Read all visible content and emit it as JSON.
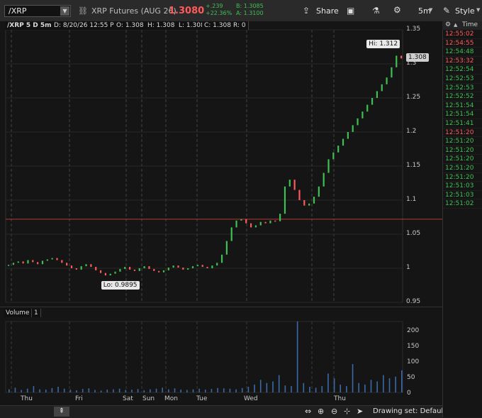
{
  "toolbar": {
    "symbol": "/XRP",
    "description": "XRP Futures (AUG 26)",
    "last": "1.3080",
    "change_abs": "+.239",
    "change_pct": "+22.36%",
    "bid": "B: 1.3085",
    "ask": "A: 1.3100",
    "share_label": "Share",
    "timeframe_label": "5m",
    "style_label": "Style"
  },
  "chart_header": {
    "title": "/XRP 5 D 5m",
    "date": "D: 8/20/26 12:55 PM",
    "open": "O: 1.308",
    "high": "H: 1.308",
    "low": "L: 1.308",
    "close": "C: 1.308",
    "range": "R: 0"
  },
  "annotations": {
    "hi_label": "Hi: 1.312",
    "lo_label": "Lo: 0.9895",
    "last_price_tag": "1.308"
  },
  "volume": {
    "title": "Volume",
    "badge": "1",
    "axis": [
      "200",
      "150",
      "100",
      "50",
      "0"
    ]
  },
  "bottom": {
    "drawing_set": "Drawing set: Default"
  },
  "tape": {
    "header": "Time",
    "rows": [
      {
        "t": "12:55:02",
        "c": "red"
      },
      {
        "t": "12:54:55",
        "c": "red"
      },
      {
        "t": "12:54:48",
        "c": "grn"
      },
      {
        "t": "12:53:32",
        "c": "red"
      },
      {
        "t": "12:52:54",
        "c": "grn"
      },
      {
        "t": "12:52:53",
        "c": "grn"
      },
      {
        "t": "12:52:53",
        "c": "grn"
      },
      {
        "t": "12:52:52",
        "c": "grn"
      },
      {
        "t": "12:51:54",
        "c": "grn"
      },
      {
        "t": "12:51:54",
        "c": "grn"
      },
      {
        "t": "12:51:41",
        "c": "grn"
      },
      {
        "t": "12:51:20",
        "c": "red"
      },
      {
        "t": "12:51:20",
        "c": "grn"
      },
      {
        "t": "12:51:20",
        "c": "grn"
      },
      {
        "t": "12:51:20",
        "c": "grn"
      },
      {
        "t": "12:51:20",
        "c": "grn"
      },
      {
        "t": "12:51:20",
        "c": "grn"
      },
      {
        "t": "12:51:03",
        "c": "grn"
      },
      {
        "t": "12:51:03",
        "c": "grn"
      },
      {
        "t": "12:51:02",
        "c": "grn"
      }
    ]
  },
  "chart_data": {
    "type": "line",
    "x_ticks": [
      "Thu",
      "Fri",
      "Sat",
      "Sun",
      "Mon",
      "Tue",
      "Wed",
      "Thu"
    ],
    "y_ticks": [
      1.35,
      1.3,
      1.25,
      1.2,
      1.15,
      1.1,
      1.05,
      1,
      0.95
    ],
    "ylim": [
      0.95,
      1.35
    ],
    "price_line": 1.072,
    "high": 1.312,
    "low": 0.9895,
    "last": 1.308,
    "series": [
      {
        "values": [
          1.005,
          1.008,
          1.01,
          1.007,
          1.012,
          1.009,
          1.006,
          1.011,
          1.013,
          1.015,
          1.012,
          1.008,
          1.004,
          1.0,
          0.998,
          1.003,
          1.006,
          1.002,
          0.997,
          0.993,
          0.9895,
          0.992,
          0.995,
          0.999,
          1.002,
          0.998,
          0.996,
          1.0,
          1.003,
          0.999,
          0.996,
          0.994,
          0.997,
          1.001,
          1.004,
          1.001,
          0.998,
          1.0,
          1.003,
          1.005,
          1.002,
          1.0,
          1.004,
          1.008,
          1.02,
          1.04,
          1.06,
          1.07,
          1.072,
          1.066,
          1.06,
          1.063,
          1.068,
          1.066,
          1.07,
          1.069,
          1.08,
          1.12,
          1.13,
          1.115,
          1.1,
          1.092,
          1.095,
          1.105,
          1.12,
          1.14,
          1.16,
          1.17,
          1.18,
          1.19,
          1.2,
          1.21,
          1.22,
          1.23,
          1.24,
          1.25,
          1.26,
          1.27,
          1.28,
          1.295,
          1.312,
          1.308
        ]
      }
    ],
    "volume_values": [
      10,
      15,
      8,
      12,
      20,
      10,
      9,
      14,
      18,
      12,
      9,
      7,
      11,
      13,
      8,
      6,
      9,
      10,
      12,
      8,
      9,
      11,
      7,
      10,
      12,
      15,
      10,
      13,
      9,
      8,
      10,
      12,
      9,
      11,
      14,
      13,
      12,
      10,
      14,
      18,
      25,
      40,
      30,
      35,
      55,
      22,
      20,
      230,
      30,
      18,
      15,
      20,
      60,
      45,
      25,
      20,
      90,
      30,
      25,
      40,
      35,
      55,
      45,
      50,
      70
    ]
  }
}
